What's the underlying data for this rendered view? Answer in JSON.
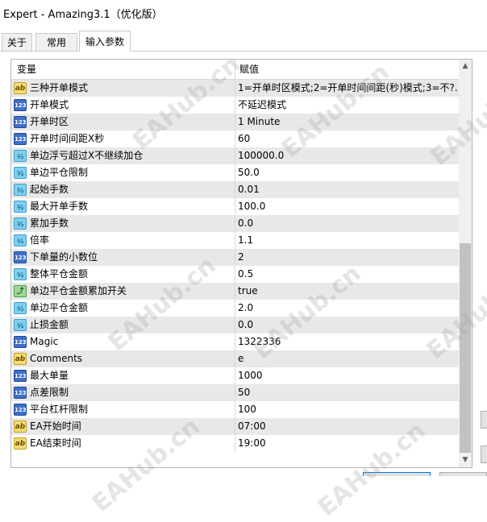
{
  "window": {
    "title": "Expert - Amazing3.1（优化版）"
  },
  "tabs": [
    {
      "label": "关于",
      "active": false
    },
    {
      "label": "常用",
      "active": false
    },
    {
      "label": "输入参数",
      "active": true
    }
  ],
  "table": {
    "columns": {
      "name": "变量",
      "value": "赋值"
    },
    "rows": [
      {
        "icon": "ab",
        "name": "三种开单模式",
        "value": "1=开单时区模式;2=开单时间间距(秒)模式;3=不?.."
      },
      {
        "icon": "123",
        "name": "开单模式",
        "value": "不延迟模式"
      },
      {
        "icon": "123",
        "name": "开单时区",
        "value": "1 Minute"
      },
      {
        "icon": "123",
        "name": "开单时间间距X秒",
        "value": "60"
      },
      {
        "icon": "v2",
        "name": "单边浮亏超过X不继续加仓",
        "value": "100000.0"
      },
      {
        "icon": "v2",
        "name": "单边平仓限制",
        "value": "50.0"
      },
      {
        "icon": "v2",
        "name": "起始手数",
        "value": "0.01"
      },
      {
        "icon": "v2",
        "name": "最大开单手数",
        "value": "100.0"
      },
      {
        "icon": "v2",
        "name": "累加手数",
        "value": "0.0"
      },
      {
        "icon": "v2",
        "name": "倍率",
        "value": "1.1"
      },
      {
        "icon": "123",
        "name": "下单量的小数位",
        "value": "2"
      },
      {
        "icon": "v2",
        "name": "整体平仓金额",
        "value": "0.5"
      },
      {
        "icon": "bool",
        "name": "单边平仓金额累加开关",
        "value": "true"
      },
      {
        "icon": "v2",
        "name": "单边平仓金额",
        "value": "2.0"
      },
      {
        "icon": "v2",
        "name": "止损金额",
        "value": "0.0"
      },
      {
        "icon": "123",
        "name": "Magic",
        "value": "1322336"
      },
      {
        "icon": "ab",
        "name": "Comments",
        "value": "e"
      },
      {
        "icon": "123",
        "name": "最大单量",
        "value": "1000"
      },
      {
        "icon": "123",
        "name": "点差限制",
        "value": "50"
      },
      {
        "icon": "123",
        "name": "平台杠杆限制",
        "value": "100"
      },
      {
        "icon": "ab",
        "name": "EA开始时间",
        "value": "07:00"
      },
      {
        "icon": "ab",
        "name": "EA结束时间",
        "value": "19:00"
      }
    ]
  },
  "icon_labels": {
    "ab": "ab",
    "123": "123",
    "v2": "½",
    "bool": "⤴"
  },
  "scrollbar": {
    "up_arrow": "▲",
    "down_arrow": "▼"
  },
  "watermark": "EAHub.cn"
}
